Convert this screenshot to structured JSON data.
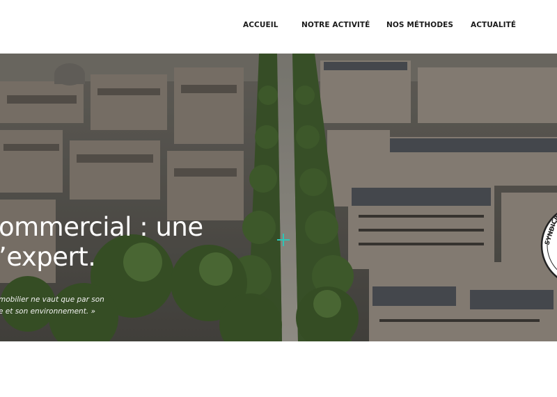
{
  "nav": {
    "items": [
      {
        "label": "ACCUEIL"
      },
      {
        "label": "NOTRE ACTIVITÉ"
      },
      {
        "label": "NOS MÉTHODES"
      },
      {
        "label": "ACTUALITÉ"
      }
    ]
  },
  "hero": {
    "title_line1": "ommercial : une",
    "title_line2": "’expert.",
    "subtitle_line1": "mobilier ne vaut que par son",
    "subtitle_line2": "e et son environnement. »",
    "stamp_text": "SYNDICA"
  },
  "colors": {
    "nav_text": "#1a1a1a",
    "hero_text": "#ffffff",
    "cursor": "#2ec4b6",
    "background": "#ffffff"
  },
  "icons": {
    "cursor": "crosshair-cursor-icon",
    "stamp": "seal-badge-icon"
  }
}
